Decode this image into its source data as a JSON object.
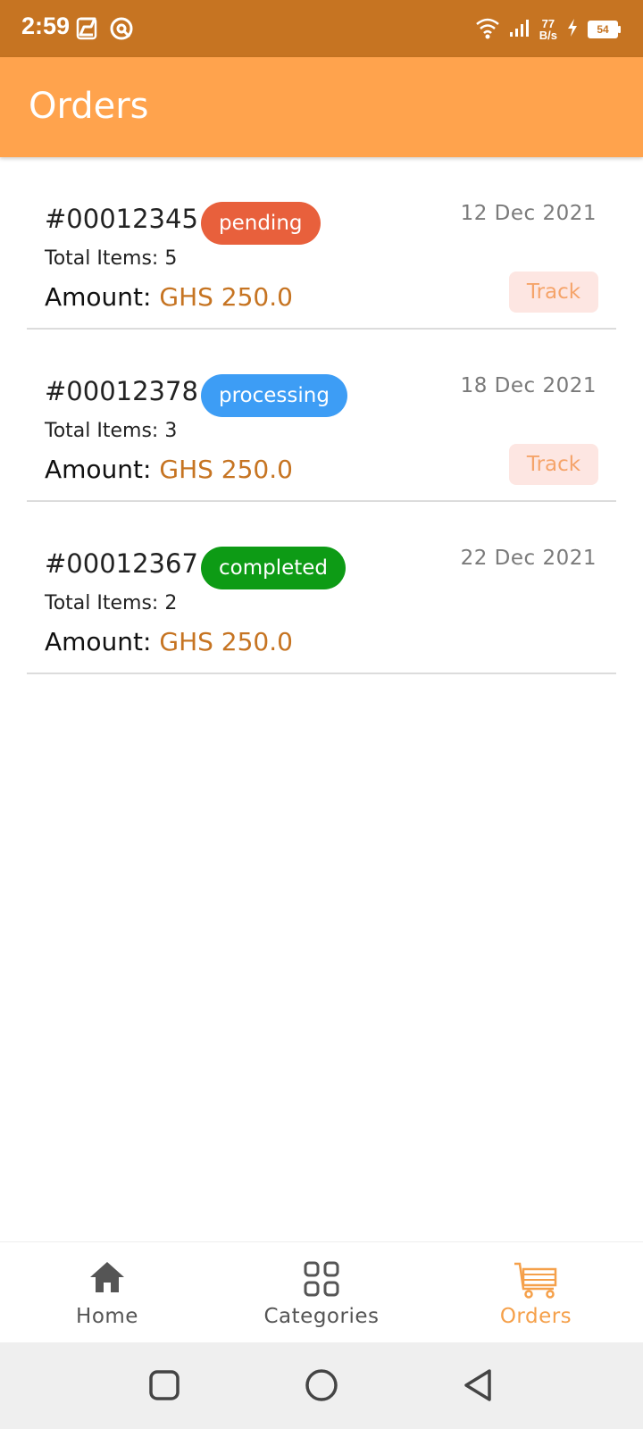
{
  "status_bar": {
    "time": "2:59",
    "speed_value": "77",
    "speed_unit": "B/s",
    "battery": "54"
  },
  "header": {
    "title": "Orders"
  },
  "orders": [
    {
      "id": "#00012345",
      "status": "pending",
      "status_color": "#e8603c",
      "items": "Total Items: 5",
      "amount_label": "Amount:",
      "amount_value": "GHS 250.0",
      "date": "12 Dec 2021",
      "track_label": "Track"
    },
    {
      "id": "#00012378",
      "status": "processing",
      "status_color": "#3d9df5",
      "items": "Total Items: 3",
      "amount_label": "Amount:",
      "amount_value": "GHS 250.0",
      "date": "18 Dec 2021",
      "track_label": "Track"
    },
    {
      "id": "#00012367",
      "status": "completed",
      "status_color": "#0d9b15",
      "items": "Total Items: 2",
      "amount_label": "Amount:",
      "amount_value": "GHS 250.0",
      "date": "22 Dec 2021"
    }
  ],
  "bottom_nav": {
    "items": [
      {
        "label": "Home",
        "icon": "home-icon"
      },
      {
        "label": "Categories",
        "icon": "grid-icon"
      },
      {
        "label": "Orders",
        "icon": "cart-icon",
        "active": true
      }
    ]
  },
  "colors": {
    "status_bar": "#c67422",
    "app_bar": "#ffa34d",
    "accent": "#f5a04a",
    "amount": "#c67422"
  }
}
